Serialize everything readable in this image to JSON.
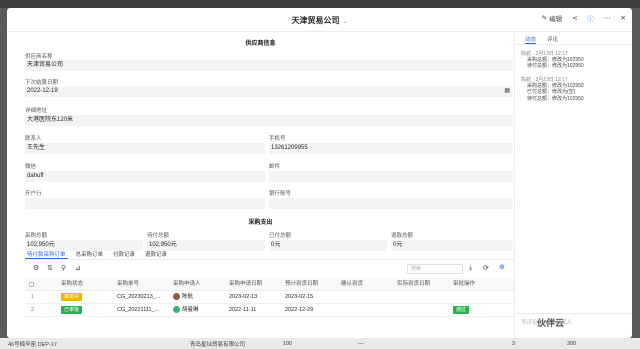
{
  "window": {
    "bg_title": "采购管理"
  },
  "header": {
    "title": "天津贸易公司",
    "edit_label": "编辑"
  },
  "supplier_info": {
    "section_title": "供应商信息",
    "name_label": "供应商名称",
    "name_value": "天津贸易公司",
    "next_date_label": "下次结算日期",
    "next_date_value": "2022-12-19",
    "address_label": "详细地址",
    "address_value": "大港医院东120米",
    "contact_label": "联系人",
    "contact_value": "王先生",
    "phone_label": "手机号",
    "phone_value": "13261209955",
    "wechat_label": "微信",
    "wechat_value": "dahuff",
    "email_label": "邮件",
    "email_value": "",
    "bank_label": "开户行",
    "bank_value": "",
    "account_label": "银行账号",
    "account_value": ""
  },
  "purchase": {
    "section_title": "采购支出",
    "total_label": "采购总额",
    "total_value": "102,950元",
    "pending_label": "待付总额",
    "pending_value": "102,950元",
    "paid_label": "已付总额",
    "paid_value": "0元",
    "refund_label": "退款总额",
    "refund_value": "0元"
  },
  "tabs": [
    "待付款采购订单",
    "总采购订单",
    "付款记录",
    "退款记录"
  ],
  "toolbar": {
    "search_placeholder": "搜索"
  },
  "table": {
    "headers": [
      "采购状态",
      "采购单号",
      "采购申请人",
      "采购申请日期",
      "预计到货日期",
      "确认到货",
      "实际到货日期",
      "审批操作"
    ],
    "rows": [
      {
        "num": "1",
        "status": "审批中",
        "status_color": "#f0b400",
        "order_no": "CG_20230213_...",
        "applicant": "陈航",
        "apply_date": "2023-02-13",
        "expected_date": "2023-02-15",
        "confirmed": "",
        "actual_date": "",
        "action": ""
      },
      {
        "num": "2",
        "status": "已审批",
        "status_color": "#2bb24c",
        "order_no": "CG_20221111_...",
        "applicant": "胡曼琳",
        "apply_date": "2022-11-11",
        "expected_date": "2022-12-29",
        "confirmed": "",
        "actual_date": "",
        "action": "通过"
      }
    ]
  },
  "side": {
    "tab_activity": "动态",
    "tab_comment": "评论",
    "activities": [
      {
        "user": "陈航",
        "time": "2月13日 12:17",
        "lines": [
          "采购总额：修改为102950",
          "待付总额：修改为102950"
        ]
      },
      {
        "user": "陈航",
        "time": "2月13日 12:17",
        "lines": [
          "采购总额：修改为102950",
          "已付总额：修改为(空)",
          "待付总额：修改为102950"
        ]
      }
    ],
    "comment_placeholder": "写评论，@ 提及某人"
  },
  "background": {
    "row_cells": [
      "46号楠辛座 DEP-17",
      "青岛星灿贸易有限公司",
      "100",
      "—",
      "3",
      "300"
    ]
  },
  "watermark": "伙伴云"
}
